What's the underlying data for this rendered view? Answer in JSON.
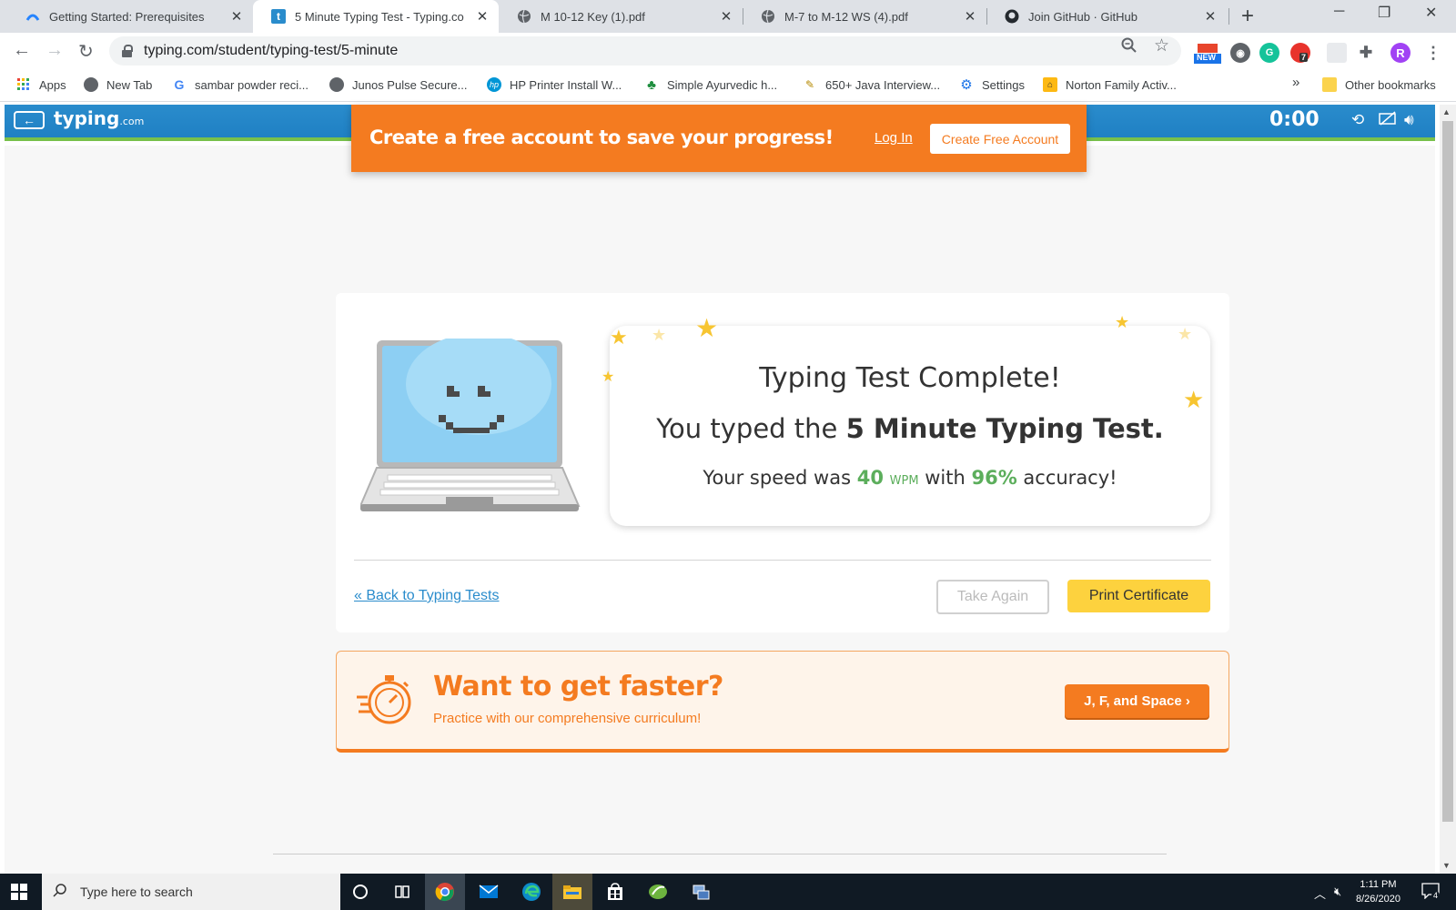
{
  "browser": {
    "tabs": [
      {
        "title": "Getting Started: Prerequisites",
        "icon": "atlassian-icon"
      },
      {
        "title": "5 Minute Typing Test - Typing.co",
        "icon": "typing-favicon-icon"
      },
      {
        "title": "M 10-12 Key (1).pdf",
        "icon": "globe-icon"
      },
      {
        "title": "M-7 to M-12 WS (4).pdf",
        "icon": "globe-icon"
      },
      {
        "title": "Join GitHub · GitHub",
        "icon": "github-icon"
      }
    ],
    "url": "typing.com/student/typing-test/5-minute",
    "profile_initial": "R",
    "ext_badges": {
      "new": "NEW",
      "count": "7"
    },
    "bookmarks": [
      {
        "label": "Apps"
      },
      {
        "label": "New Tab"
      },
      {
        "label": "sambar powder reci..."
      },
      {
        "label": "Junos Pulse Secure..."
      },
      {
        "label": "HP Printer Install W..."
      },
      {
        "label": "Simple Ayurvedic h..."
      },
      {
        "label": "650+ Java Interview..."
      },
      {
        "label": "Settings"
      },
      {
        "label": "Norton Family Activ..."
      }
    ],
    "overflow": "»",
    "other_bookmarks": "Other bookmarks"
  },
  "app": {
    "logo": "typing",
    "logo_suffix": ".com",
    "timer": "0:00"
  },
  "promo": {
    "text": "Create a free account to save your progress!",
    "login": "Log In",
    "create": "Create Free Account"
  },
  "result": {
    "title": "Typing Test Complete!",
    "typed_prefix": "You typed the ",
    "test_name": "5 Minute Typing Test.",
    "speed_prefix": "Your speed was ",
    "wpm": "40",
    "wpm_unit": "WPM",
    "with": " with ",
    "accuracy": "96%",
    "accuracy_suffix": " accuracy!"
  },
  "actions": {
    "back": "« Back to Typing Tests",
    "take_again": "Take Again",
    "print": "Print Certificate"
  },
  "faster": {
    "title": "Want to get faster?",
    "subtitle": "Practice with our comprehensive curriculum!",
    "button": "J, F, and Space ›"
  },
  "taskbar": {
    "search_placeholder": "Type here to search",
    "time": "1:11 PM",
    "date": "8/26/2020",
    "notifications": "4"
  },
  "colors": {
    "brand_blue": "#2a8ccc",
    "brand_orange": "#f47b20",
    "accent_green": "#5cae5c",
    "button_yellow": "#fdd23e"
  }
}
